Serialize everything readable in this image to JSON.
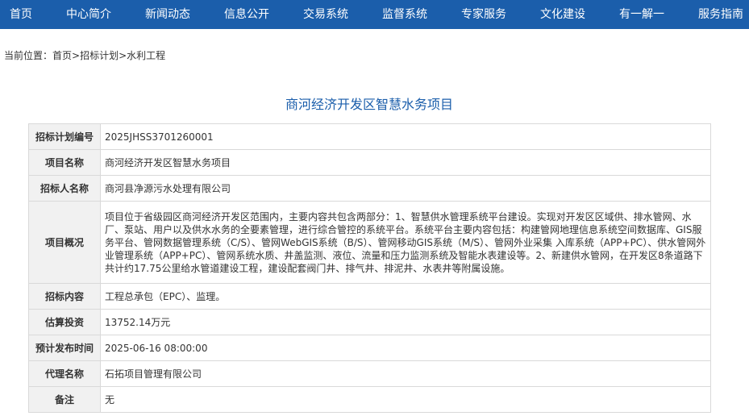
{
  "nav": {
    "items": [
      {
        "label": "首页"
      },
      {
        "label": "中心简介"
      },
      {
        "label": "新闻动态"
      },
      {
        "label": "信息公开"
      },
      {
        "label": "交易系统"
      },
      {
        "label": "监督系统"
      },
      {
        "label": "专家服务"
      },
      {
        "label": "文化建设"
      },
      {
        "label": "有一解一"
      },
      {
        "label": "服务指南"
      }
    ]
  },
  "breadcrumb": {
    "prefix": "当前位置：",
    "home": "首页",
    "sep1": ">",
    "section": "招标计划",
    "sep2": ">",
    "current": "水利工程"
  },
  "page_title": "商河经济开发区智慧水务项目",
  "table": {
    "rows": [
      {
        "label": "招标计划编号",
        "value": "2025JHSS3701260001"
      },
      {
        "label": "项目名称",
        "value": "商河经济开发区智慧水务项目"
      },
      {
        "label": "招标人名称",
        "value": "商河县净源污水处理有限公司"
      },
      {
        "label": "项目概况",
        "value": "项目位于省级园区商河经济开发区范围内，主要内容共包含两部分：1、智慧供水管理系统平台建设。实现对开发区区域供、排水管网、水厂、泵站、用户以及供水水务的全要素管理，进行综合管控的系统平台。系统平台主要内容包括：构建管网地理信息系统空间数据库、GIS服务平台、管网数据管理系统（C/S）、管网WebGIS系统（B/S）、管网移动GIS系统（M/S）、管网外业采集 入库系统（APP+PC）、供水管网外业管理系统（APP+PC）、管网系统水质、井盖监测、液位、流量和压力监测系统及智能水表建设等。2、新建供水管网，在开发区8条道路下共计约17.75公里给水管道建设工程，建设配套阀门井、排气井、排泥井、水表井等附属设施。"
      },
      {
        "label": "招标内容",
        "value": "工程总承包（EPC）、监理。"
      },
      {
        "label": "估算投资",
        "value": "13752.14万元"
      },
      {
        "label": "预计发布时间",
        "value": "2025-06-16 08:00:00"
      },
      {
        "label": "代理名称",
        "value": "石拓项目管理有限公司"
      },
      {
        "label": "备注",
        "value": "无"
      }
    ]
  },
  "colors": {
    "nav_bg": "#1b5eab",
    "title": "#1b5eab",
    "label_bg": "#f1f1f1",
    "border": "#d9d9d9"
  }
}
